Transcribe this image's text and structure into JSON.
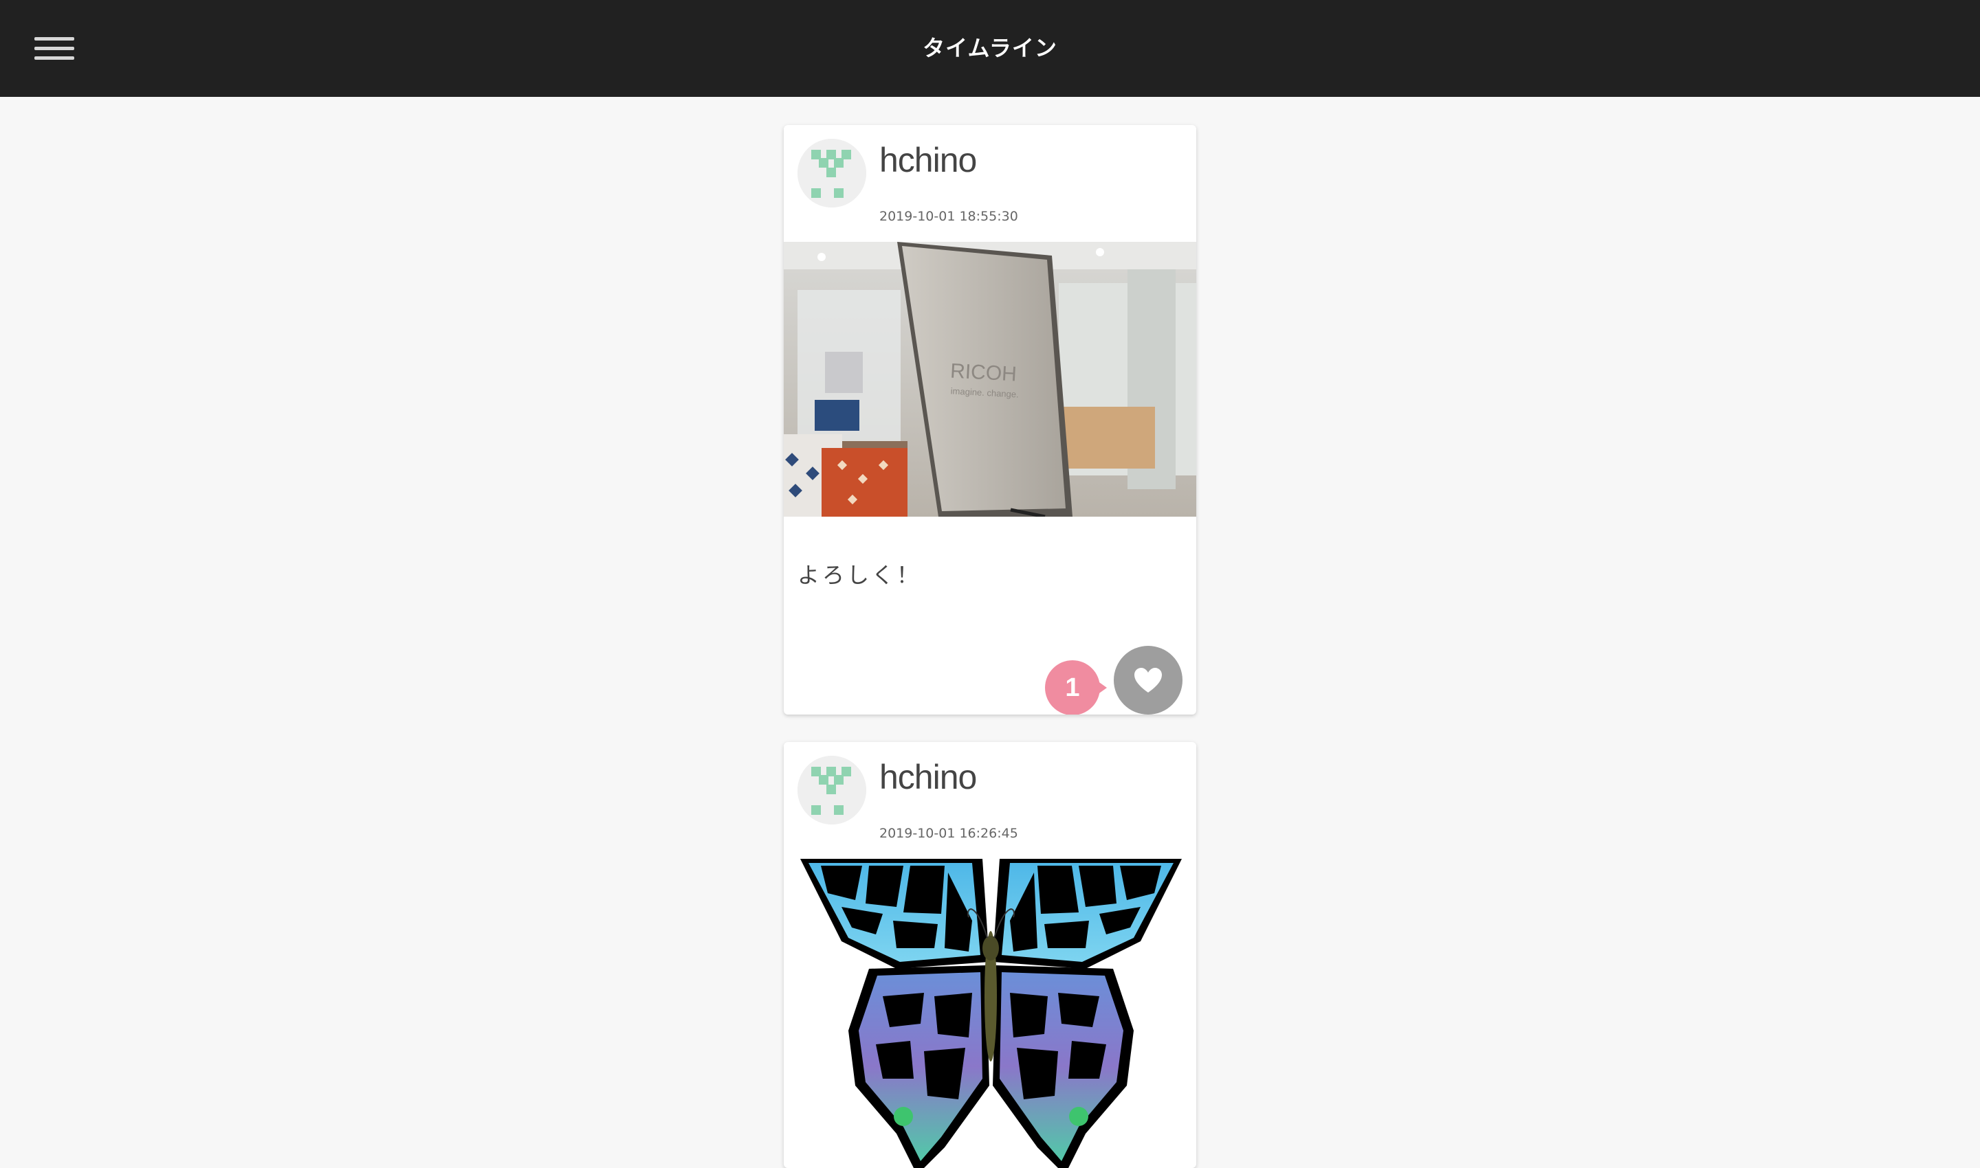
{
  "header": {
    "title": "タイムライン",
    "menu_icon": "hamburger-menu-icon"
  },
  "posts": [
    {
      "username": "hchino",
      "timestamp": "2019-10-01 18:55:30",
      "image_sign_text": "RICOH",
      "image_sign_subtext": "imagine. change.",
      "text": "よろしく！",
      "like_count": "1",
      "like_icon": "heart-icon"
    },
    {
      "username": "hchino",
      "timestamp": "2019-10-01 16:26:45",
      "image_desc": "butterfly"
    }
  ],
  "colors": {
    "header_bg": "#212121",
    "like_badge": "#f08ca0",
    "like_button": "#9e9e9e",
    "avatar_pattern": "#8fd3b0"
  }
}
